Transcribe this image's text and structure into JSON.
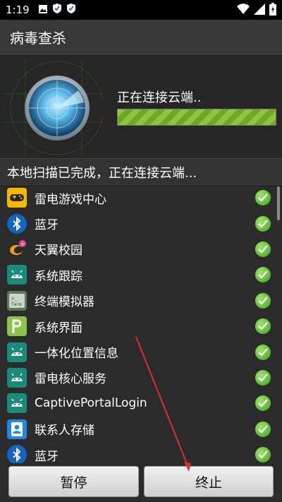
{
  "status_bar": {
    "time": "1:19"
  },
  "app": {
    "title": "病毒查杀"
  },
  "scan": {
    "status_text": "正在连接云端..",
    "progress_fraction": 1.0,
    "local_status": "本地扫描已完成，正在连接云端..."
  },
  "apps": [
    {
      "name": "雷电游戏中心",
      "icon": "gamepad-icon",
      "icon_bg": "#f5b800"
    },
    {
      "name": "蓝牙",
      "icon": "bluetooth-icon",
      "icon_bg": "#1565c0"
    },
    {
      "name": "天翼校园",
      "icon": "tianyi-icon",
      "icon_bg": "#2b2b2b"
    },
    {
      "name": "系统跟踪",
      "icon": "android-icon",
      "icon_bg": "#1a8a7a"
    },
    {
      "name": "终端模拟器",
      "icon": "terminal-icon",
      "icon_bg": "#5f7a5a"
    },
    {
      "name": "系统界面",
      "icon": "android-p-icon",
      "icon_bg": "#8bc34a"
    },
    {
      "name": "一体化位置信息",
      "icon": "android-icon",
      "icon_bg": "#1a8a7a"
    },
    {
      "name": "雷电核心服务",
      "icon": "android-icon",
      "icon_bg": "#1a8a7a"
    },
    {
      "name": "CaptivePortalLogin",
      "icon": "android-icon",
      "icon_bg": "#1a8a7a"
    },
    {
      "name": "联系人存储",
      "icon": "contacts-icon",
      "icon_bg": "#1e88e5"
    },
    {
      "name": "蓝牙",
      "icon": "bluetooth-icon",
      "icon_bg": "#1565c0"
    }
  ],
  "buttons": {
    "pause": "暂停",
    "stop": "终止"
  },
  "colors": {
    "progress": "#8cc63f",
    "check": "#3aa51a",
    "annotation_arrow": "#d9302c"
  }
}
